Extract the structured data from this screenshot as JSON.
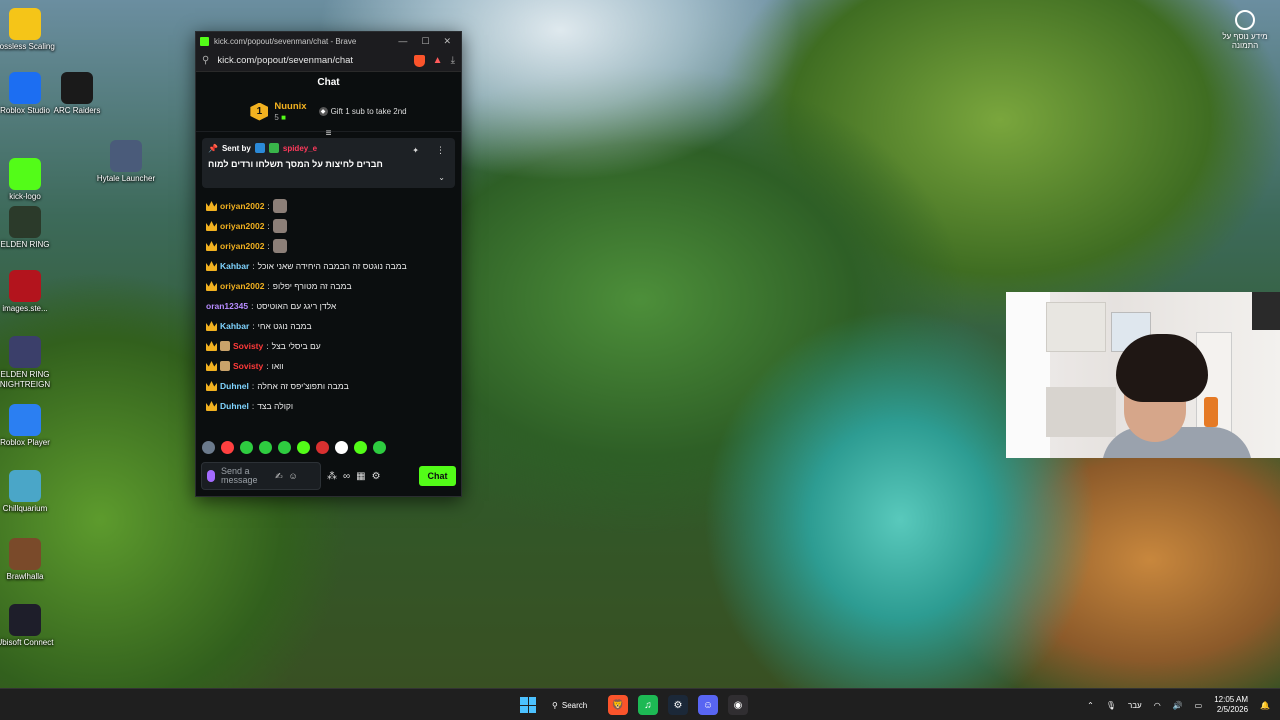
{
  "desktop_icons": [
    {
      "label": "Lossless Scaling",
      "icon": "duck-icon",
      "color": "#f5c518"
    },
    {
      "label": "Roblox Studio",
      "icon": "roblox-studio-icon",
      "color": "#1c6ef2"
    },
    {
      "label": "ARC Raiders",
      "icon": "arc-raiders-icon",
      "color": "#1a1a1a"
    },
    {
      "label": "Hytale Launcher",
      "icon": "hytale-icon",
      "color": "#4a5b7a"
    },
    {
      "label": "kick-logo",
      "icon": "kick-icon",
      "color": "#53fc18"
    },
    {
      "label": "ELDEN RING",
      "icon": "elden-ring-icon",
      "color": "#2b3a2a"
    },
    {
      "label": "images.ste...",
      "icon": "image-file-icon",
      "color": "#b3141d"
    },
    {
      "label": "ELDEN RING NIGHTREIGN",
      "icon": "nightreign-icon",
      "color": "#3b3f6a"
    },
    {
      "label": "Roblox Player",
      "icon": "roblox-player-icon",
      "color": "#2b7ff2"
    },
    {
      "label": "Chillquarium",
      "icon": "fish-icon",
      "color": "#4aa6c8"
    },
    {
      "label": "Brawlhalla",
      "icon": "brawlhalla-icon",
      "color": "#7a4a2a"
    },
    {
      "label": "Ubisoft Connect",
      "icon": "ubisoft-icon",
      "color": "#1e1e2a"
    }
  ],
  "browser": {
    "title": "kick.com/popout/sevenman/chat - Brave",
    "url": "kick.com/popout/sevenman/chat",
    "window_controls": [
      "—",
      "☐",
      "✕"
    ],
    "header_title": "Chat"
  },
  "leaderboard": {
    "rank": "1",
    "name": "Nuunix",
    "count": "5",
    "gift_text": "Gift 1 sub to take 2nd"
  },
  "pinned": {
    "sent_by_label": "Sent by",
    "sender": "spidey_e",
    "message": "חברים לחיצות על המסך תשלחו ורדים למוח"
  },
  "messages": [
    {
      "user": "oriyan2002",
      "color": "#f2b120",
      "text": "",
      "emote": true,
      "avatar": false
    },
    {
      "user": "oriyan2002",
      "color": "#f2b120",
      "text": "",
      "emote": true,
      "avatar": false
    },
    {
      "user": "oriyan2002",
      "color": "#f2b120",
      "text": "",
      "emote": true,
      "avatar": false
    },
    {
      "user": "Kahbar",
      "color": "#7fd4ff",
      "text": "במבה נוגטס זה הבמבה היחידה שאני אוכל",
      "emote": false,
      "avatar": false
    },
    {
      "user": "oriyan2002",
      "color": "#f2b120",
      "text": "במבה זה מטורף יפלופ",
      "emote": false,
      "avatar": false
    },
    {
      "user": "oran12345",
      "color": "#b78cff",
      "text": "אלדן ריגג עם האוטיסט",
      "emote": false,
      "avatar": false,
      "no_badge": true
    },
    {
      "user": "Kahbar",
      "color": "#7fd4ff",
      "text": "במבה נוגט אחי",
      "emote": false,
      "avatar": false
    },
    {
      "user": "Sovisty",
      "color": "#ff3a3a",
      "text": "עם ביסלי בצל",
      "emote": false,
      "avatar": true
    },
    {
      "user": "Sovisty",
      "color": "#ff3a3a",
      "text": "וואו",
      "emote": false,
      "avatar": true
    },
    {
      "user": "Duhnel",
      "color": "#7fd4ff",
      "text": "במבה ותפוצ'יפס זה אחלה",
      "emote": false,
      "avatar": false
    },
    {
      "user": "Duhnel",
      "color": "#7fd4ff",
      "text": "וקולה בצד",
      "emote": false,
      "avatar": false
    }
  ],
  "emote_bar": [
    "#6b7a8c",
    "#ff4040",
    "#2ecc40",
    "#2ecc40",
    "#2ecc40",
    "#53fc18",
    "#d93030",
    "#ffffff",
    "#53fc18",
    "#2ecc40"
  ],
  "input": {
    "placeholder": "Send a message",
    "chat_button": "Chat"
  },
  "top_right_widget": {
    "label": "מידע נוסף על התמונה"
  },
  "taskbar": {
    "search_label": "Search",
    "language": "עבר",
    "time": "12:05 AM",
    "date": "2/5/2026",
    "apps": [
      {
        "name": "brave-icon",
        "color": "#fb542b",
        "glyph": "🦁"
      },
      {
        "name": "spotify-icon",
        "color": "#1db954",
        "glyph": "♫"
      },
      {
        "name": "steam-icon",
        "color": "#1b2838",
        "glyph": "⚙"
      },
      {
        "name": "discord-icon",
        "color": "#5865f2",
        "glyph": "☺"
      },
      {
        "name": "obs-icon",
        "color": "#302e31",
        "glyph": "◉"
      }
    ]
  }
}
